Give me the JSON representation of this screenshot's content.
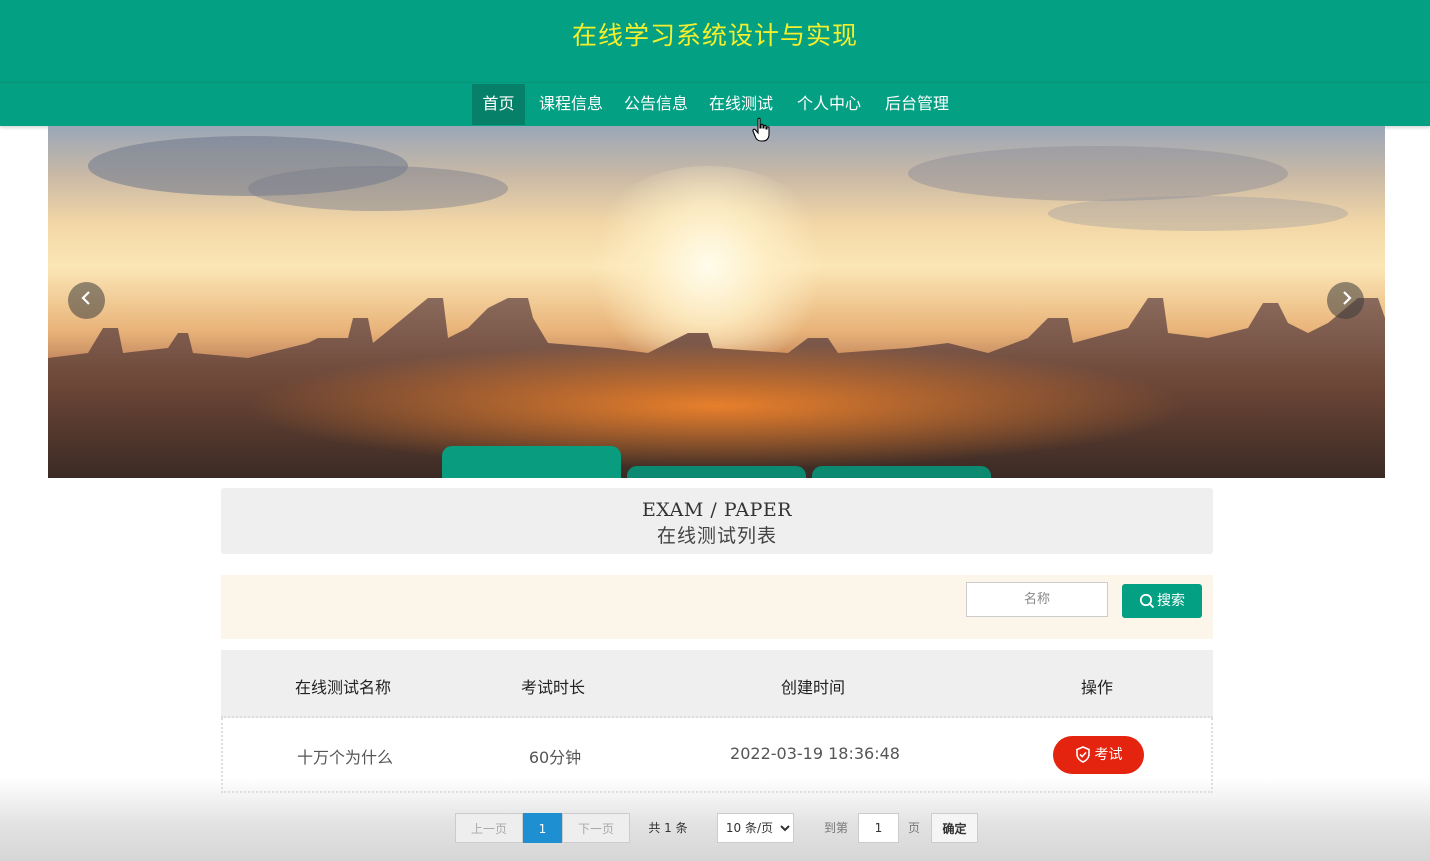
{
  "header": {
    "title": "在线学习系统设计与实现"
  },
  "nav": {
    "items": [
      {
        "label": "首页",
        "active": true
      },
      {
        "label": "课程信息",
        "active": false
      },
      {
        "label": "公告信息",
        "active": false
      },
      {
        "label": "在线测试",
        "active": false
      },
      {
        "label": "个人中心",
        "active": false
      },
      {
        "label": "后台管理",
        "active": false
      }
    ]
  },
  "banner": {
    "prev_icon": "chevron-left-icon",
    "next_icon": "chevron-right-icon",
    "slides": 3,
    "active_slide": 1
  },
  "section": {
    "title_en": "EXAM / PAPER",
    "title_cn": "在线测试列表"
  },
  "search": {
    "placeholder": "名称",
    "button_label": "搜索",
    "icon": "search-icon"
  },
  "table": {
    "headers": [
      "在线测试名称",
      "考试时长",
      "创建时间",
      "操作"
    ],
    "rows": [
      {
        "name": "十万个为什么",
        "duration": "60分钟",
        "created": "2022-03-19 18:36:48",
        "action": "考试"
      }
    ]
  },
  "pagination": {
    "prev": "上一页",
    "current": "1",
    "next": "下一页",
    "total": "共 1 条",
    "page_size": "10 条/页",
    "goto_label": "到第",
    "goto_value": "1",
    "page_unit": "页",
    "confirm": "确定"
  },
  "colors": {
    "primary": "#04a083",
    "title": "#f4ef2d",
    "danger": "#e4240f",
    "pager_active": "#1e8fd0"
  }
}
